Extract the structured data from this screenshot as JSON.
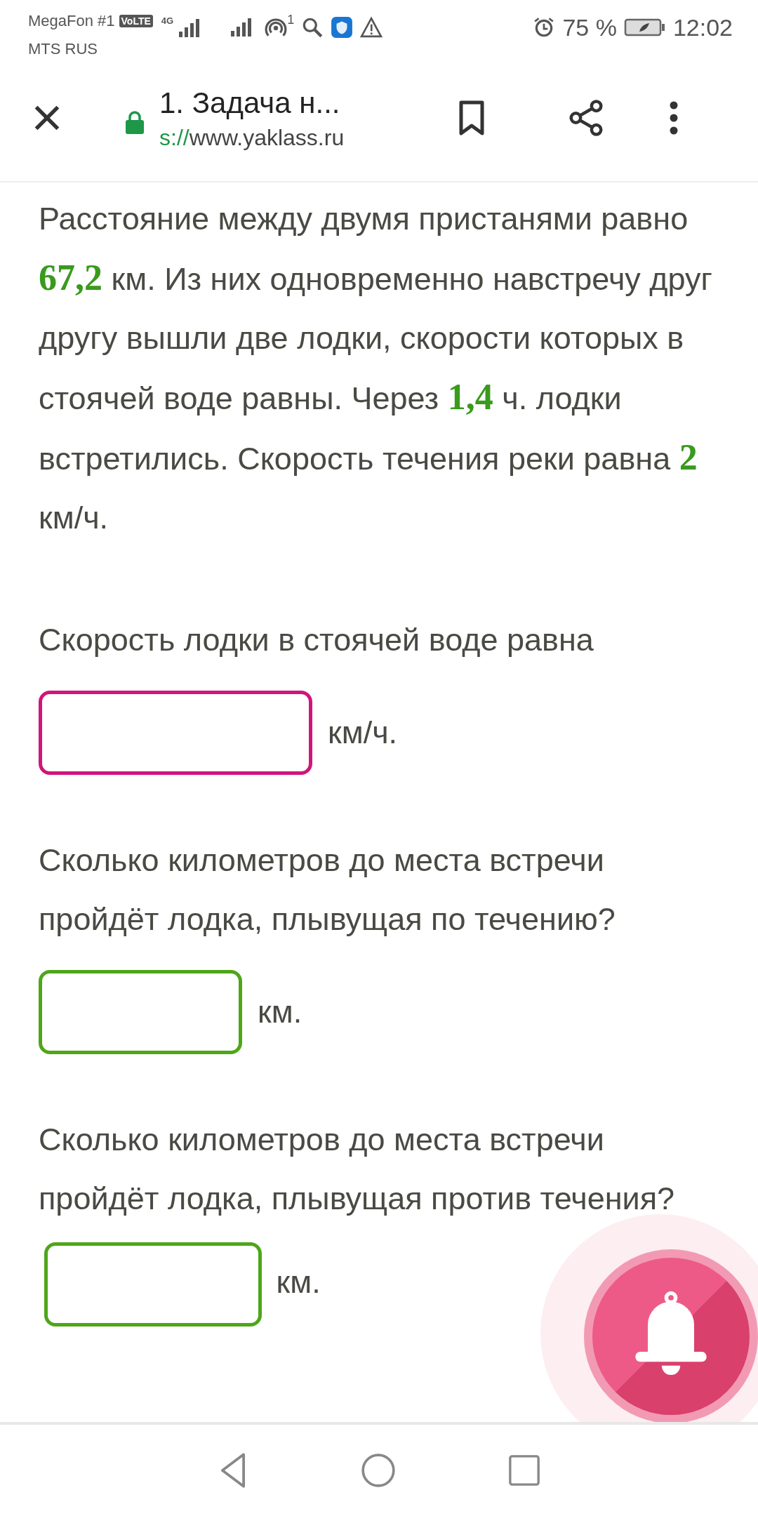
{
  "status_bar": {
    "carrier_1": "MegaFon #1",
    "volte": "VoLTE",
    "network": "4G",
    "carrier_2": "MTS RUS",
    "hotspot_count": "1",
    "battery": "75 %",
    "time": "12:02"
  },
  "header": {
    "title": "1. Задача н...",
    "url_scheme": "s://",
    "url": "www.yaklass.ru"
  },
  "problem": "Расстояние между двумя пристанями равно **67,2** км. Из них одновременно навстречу друг другу вышли две лодки, скорости которых в стоячей воде равны. Через **1,4** ч. лодки встретились. Скорость течения реки равна **2** км/ч.",
  "questions": [
    {
      "kind": "block",
      "text": "Скорость лодки в стоячей воде равна",
      "color": "#d0157c",
      "unit": "км/ч."
    },
    {
      "kind": "block",
      "text": "Сколько километров до места встречи пройдёт лодка, плывущая по течению?",
      "color": "#4ea619",
      "unit": "км."
    },
    {
      "kind": "inline",
      "text": "Сколько километров до места встречи пройдёт лодка, плывущая против течения?",
      "color": "#4ea619",
      "unit": "км."
    }
  ]
}
